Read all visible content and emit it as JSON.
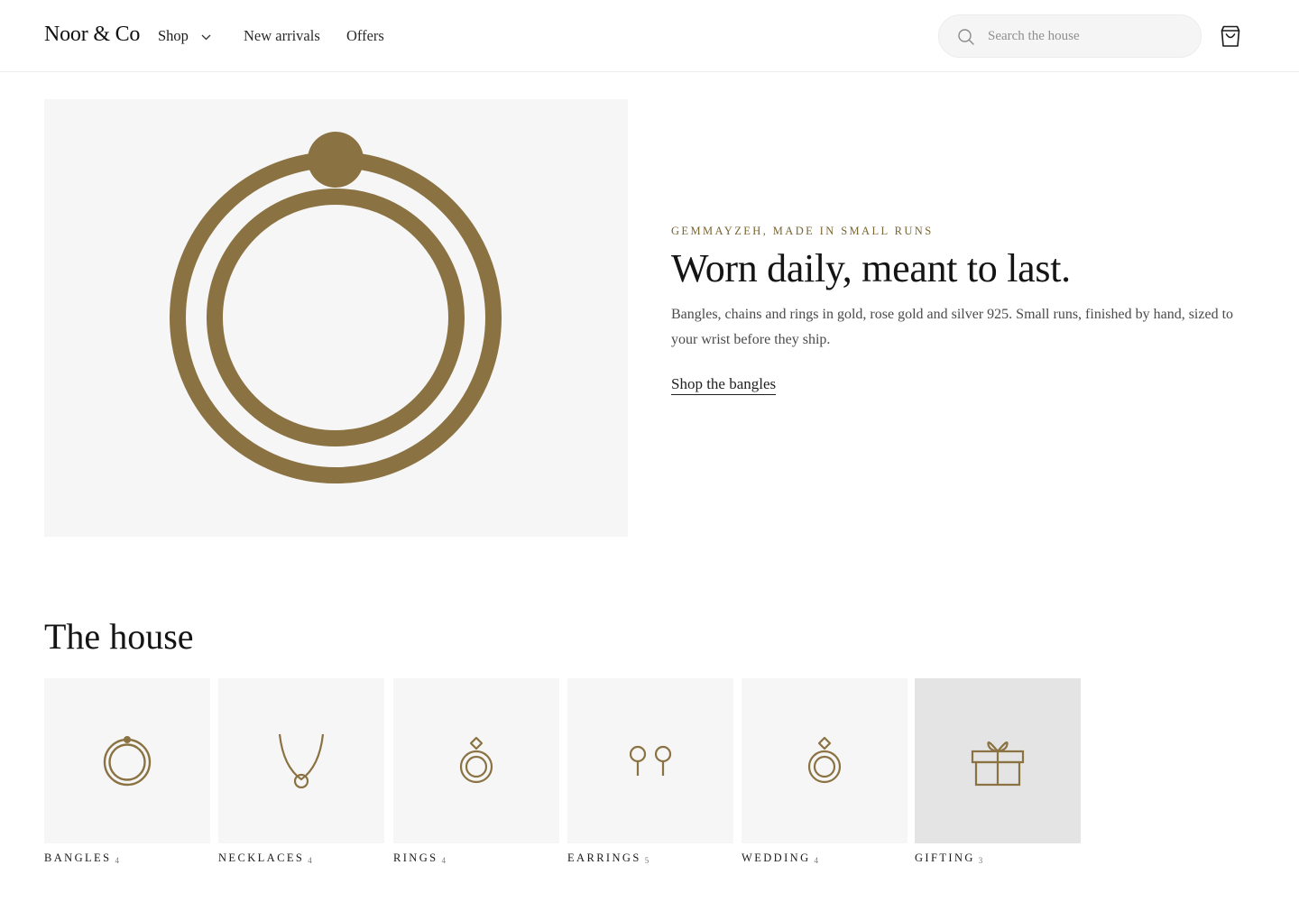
{
  "header": {
    "brand": "Noor & Co",
    "nav": {
      "shop": "Shop",
      "new_arrivals": "New arrivals",
      "offers": "Offers"
    },
    "search": {
      "placeholder": "Search the house"
    },
    "icons": {
      "search": "search-icon",
      "cart": "shopping-bag-icon",
      "shop_menu": "chevron-down-icon"
    }
  },
  "hero": {
    "eyebrow": "GEMMAYZEH, MADE IN SMALL RUNS",
    "title": "Worn daily, meant to last.",
    "body": "Bangles, chains and rings in gold, rose gold and silver 925. Small runs, finished by hand, sized to your wrist before they ship.",
    "cta": "Shop the bangles",
    "image_icon": "bangle-icon"
  },
  "house": {
    "title": "The house",
    "categories": [
      {
        "label": "BANGLES",
        "count": "4",
        "icon": "bangle-icon"
      },
      {
        "label": "NECKLACES",
        "count": "4",
        "icon": "necklace-icon"
      },
      {
        "label": "RINGS",
        "count": "4",
        "icon": "ring-icon"
      },
      {
        "label": "EARRINGS",
        "count": "5",
        "icon": "earrings-icon"
      },
      {
        "label": "WEDDING",
        "count": "4",
        "icon": "wedding-ring-icon"
      },
      {
        "label": "GIFTING",
        "count": "3",
        "icon": "gift-icon"
      }
    ],
    "active_category": "GIFTING"
  },
  "colors": {
    "accent_gold": "#8a7242",
    "eyebrow": "#7a6532",
    "tile_bg": "#f6f6f6",
    "tile_active_bg": "#e4e4e4"
  }
}
